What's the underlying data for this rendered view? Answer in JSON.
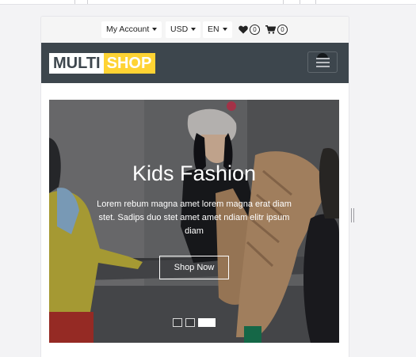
{
  "topbar": {
    "account_label": "My Account",
    "currency_label": "USD",
    "language_label": "EN",
    "wishlist_count": "0",
    "cart_count": "0"
  },
  "navbar": {
    "logo_part1": "MULTI",
    "logo_part2": "SHOP",
    "toggler_icon": "hamburger-menu-icon"
  },
  "carousel": {
    "title": "Kids Fashion",
    "text": "Lorem rebum magna amet lorem magna erat diam stet. Sadips duo stet amet amet ndiam elitr ipsum diam",
    "button_label": "Shop Now",
    "indicator_count": 3,
    "active_indicator": 3
  },
  "colors": {
    "navbar_bg": "#3d464d",
    "accent_yellow": "#ffd333",
    "topbar_bg": "#f5f5f5"
  }
}
